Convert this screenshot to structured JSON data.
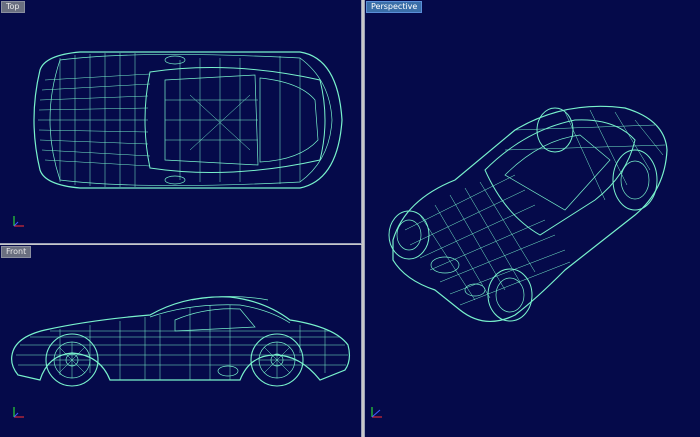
{
  "viewports": {
    "top": {
      "label": "Top",
      "active": false
    },
    "front": {
      "label": "Front",
      "active": false
    },
    "perspective": {
      "label": "Perspective",
      "active": true
    }
  },
  "colors": {
    "background": "#050a4a",
    "wireframe": "#7fffd4",
    "axis_x": "#ff3030",
    "axis_y": "#30ff30",
    "axis_z": "#4060ff",
    "active_label": "#3a6ea8"
  },
  "icons": {
    "axis_widget": "xyz-axes-icon"
  }
}
